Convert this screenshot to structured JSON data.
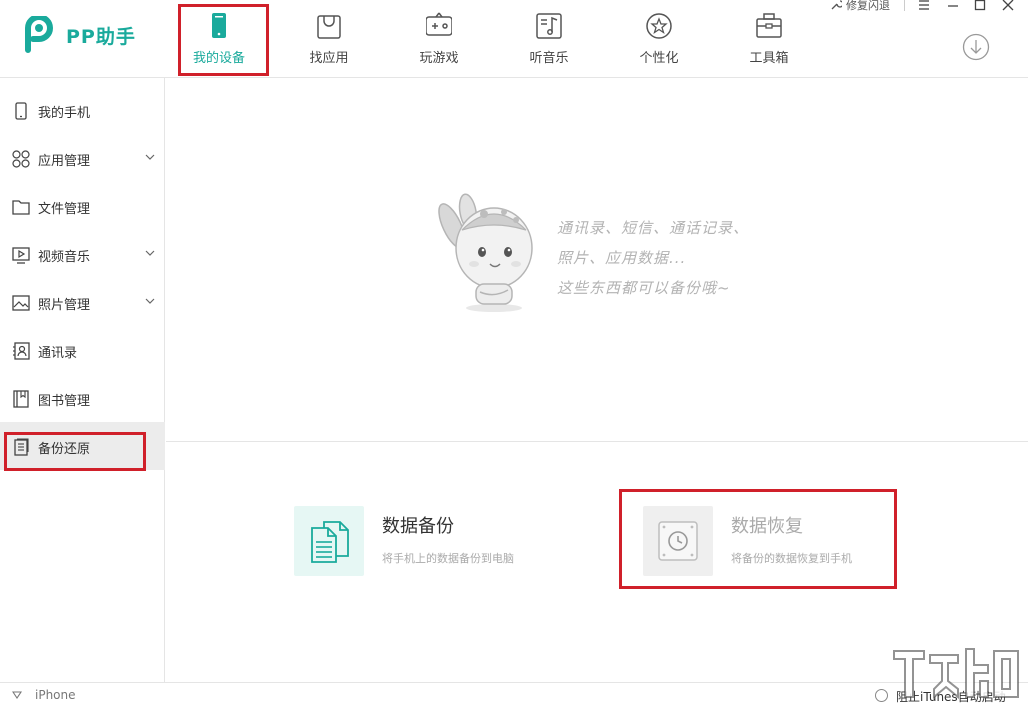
{
  "app": {
    "name": "PP助手",
    "brand_color": "#1aaa9c",
    "highlight_color": "#d0202a"
  },
  "window_controls": {
    "repair_label": "修复闪退"
  },
  "nav": {
    "tabs": [
      {
        "label": "我的设备",
        "icon": "phone-icon",
        "active": true
      },
      {
        "label": "找应用",
        "icon": "shopping-bag-icon"
      },
      {
        "label": "玩游戏",
        "icon": "gamepad-icon"
      },
      {
        "label": "听音乐",
        "icon": "music-note-icon"
      },
      {
        "label": "个性化",
        "icon": "star-icon"
      },
      {
        "label": "工具箱",
        "icon": "toolbox-icon"
      }
    ]
  },
  "sidebar": {
    "items": [
      {
        "label": "我的手机",
        "icon": "phone-outline-icon"
      },
      {
        "label": "应用管理",
        "icon": "apps-grid-icon",
        "expandable": true
      },
      {
        "label": "文件管理",
        "icon": "folder-icon"
      },
      {
        "label": "视频音乐",
        "icon": "video-icon",
        "expandable": true
      },
      {
        "label": "照片管理",
        "icon": "photo-icon",
        "expandable": true
      },
      {
        "label": "通讯录",
        "icon": "contacts-icon"
      },
      {
        "label": "图书管理",
        "icon": "book-icon"
      },
      {
        "label": "备份还原",
        "icon": "backup-doc-icon",
        "selected": true
      }
    ]
  },
  "main": {
    "hint_lines": [
      "通讯录、短信、通话记录、",
      "照片、应用数据...",
      "这些东西都可以备份哦~"
    ],
    "backup": {
      "title": "数据备份",
      "desc": "将手机上的数据备份到电脑"
    },
    "restore": {
      "title": "数据恢复",
      "desc": "将备份的数据恢复到手机"
    }
  },
  "statusbar": {
    "device": "iPhone",
    "itunes_option": "阻止iTunes自动启动"
  }
}
